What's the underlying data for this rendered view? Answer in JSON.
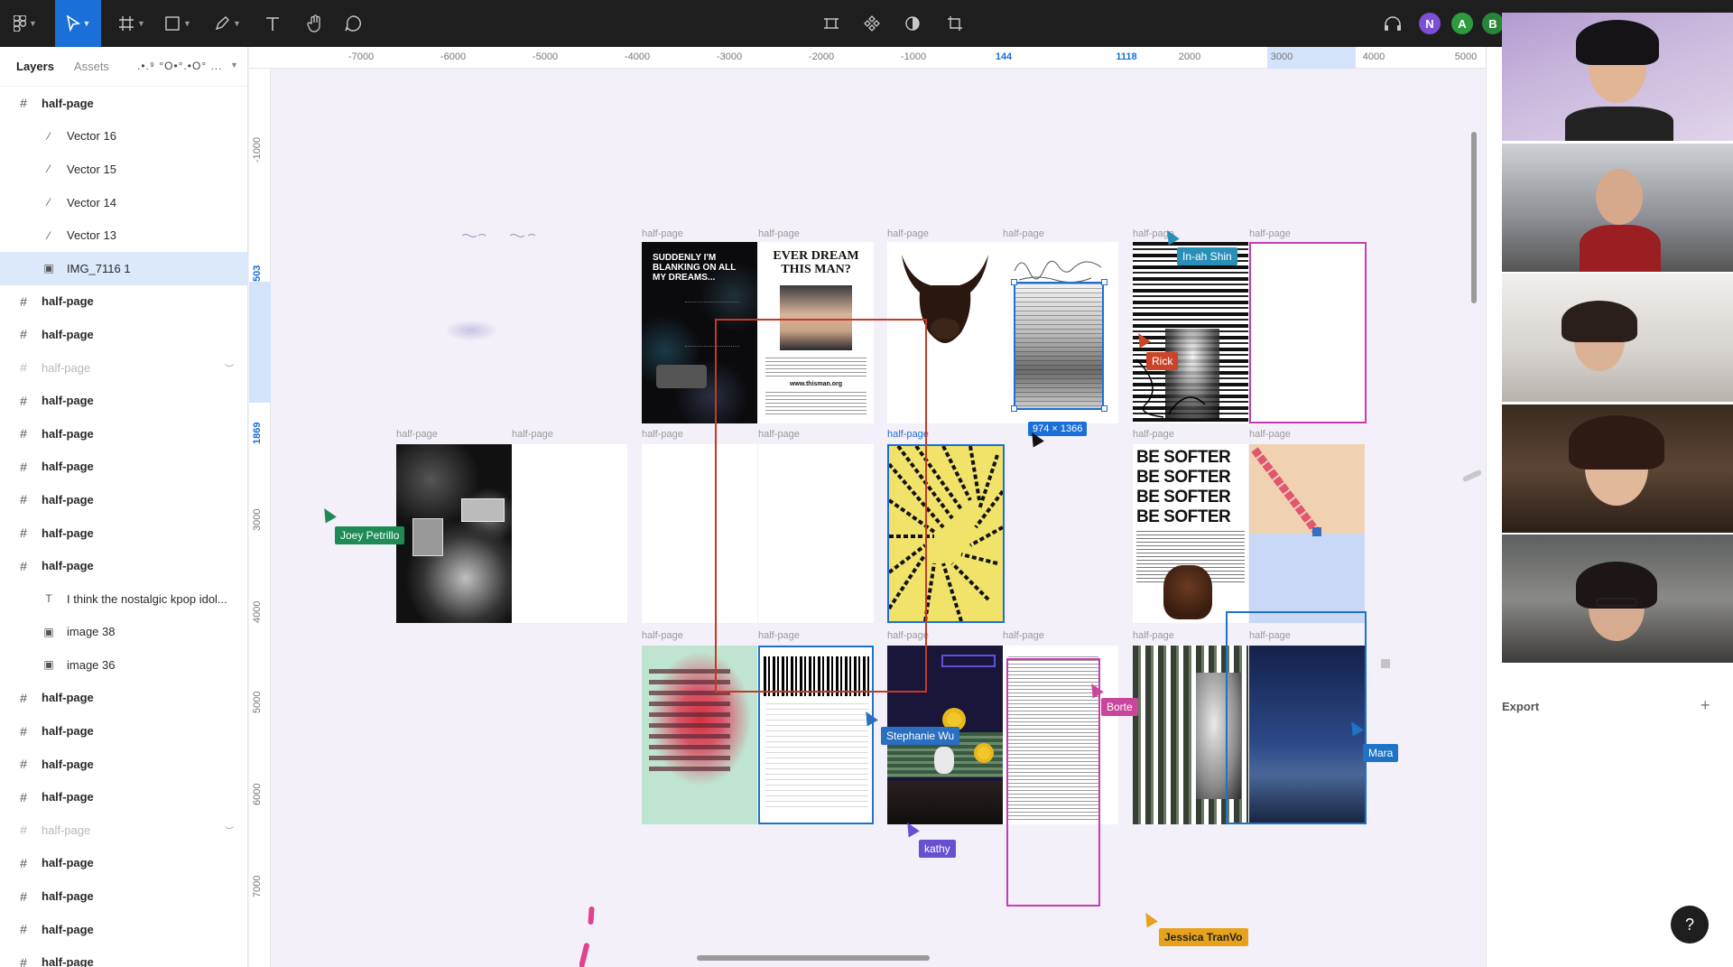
{
  "toolbar": {
    "tools": [
      "figma-menu-icon",
      "move-tool-icon",
      "frame-tool-icon",
      "shape-tool-icon",
      "pen-tool-icon",
      "text-tool-icon",
      "hand-tool-icon",
      "comment-tool-icon"
    ],
    "center_tools": [
      "component-icon",
      "components-icon",
      "mask-icon",
      "crop-icon"
    ],
    "users": [
      {
        "initial": "N",
        "color": "#7b4fd6"
      },
      {
        "initial": "A",
        "color": "#2e9a3e"
      },
      {
        "initial": "B",
        "color": "#27853a"
      }
    ]
  },
  "layers_panel": {
    "tabs": {
      "layers": "Layers",
      "assets": "Assets"
    },
    "page_name": ".•.⁹ °O•°.•O° ...",
    "items": [
      {
        "name": "half-page",
        "kind": "frame",
        "level": "top"
      },
      {
        "name": "Vector 16",
        "kind": "vector",
        "level": "child"
      },
      {
        "name": "Vector 15",
        "kind": "vector",
        "level": "child"
      },
      {
        "name": "Vector 14",
        "kind": "vector",
        "level": "child"
      },
      {
        "name": "Vector 13",
        "kind": "vector",
        "level": "child"
      },
      {
        "name": "IMG_7116 1",
        "kind": "image",
        "level": "child",
        "selected": true
      },
      {
        "name": "half-page",
        "kind": "frame",
        "level": "top"
      },
      {
        "name": "half-page",
        "kind": "frame",
        "level": "top"
      },
      {
        "name": "half-page",
        "kind": "frame",
        "level": "top",
        "hidden": true
      },
      {
        "name": "half-page",
        "kind": "frame",
        "level": "top"
      },
      {
        "name": "half-page",
        "kind": "frame",
        "level": "top"
      },
      {
        "name": "half-page",
        "kind": "frame",
        "level": "top"
      },
      {
        "name": "half-page",
        "kind": "frame",
        "level": "top"
      },
      {
        "name": "half-page",
        "kind": "frame",
        "level": "top"
      },
      {
        "name": "half-page",
        "kind": "frame",
        "level": "top"
      },
      {
        "name": "I think the nostalgic kpop idol...",
        "kind": "text",
        "level": "child"
      },
      {
        "name": "image 38",
        "kind": "image",
        "level": "child"
      },
      {
        "name": "image 36",
        "kind": "image",
        "level": "child"
      },
      {
        "name": "half-page",
        "kind": "frame",
        "level": "top"
      },
      {
        "name": "half-page",
        "kind": "frame",
        "level": "top"
      },
      {
        "name": "half-page",
        "kind": "frame",
        "level": "top"
      },
      {
        "name": "half-page",
        "kind": "frame",
        "level": "top"
      },
      {
        "name": "half-page",
        "kind": "frame",
        "level": "top",
        "hidden": true
      },
      {
        "name": "half-page",
        "kind": "frame",
        "level": "top"
      },
      {
        "name": "half-page",
        "kind": "frame",
        "level": "top"
      },
      {
        "name": "half-page",
        "kind": "frame",
        "level": "top"
      },
      {
        "name": "half-page",
        "kind": "frame",
        "level": "top"
      }
    ]
  },
  "ruler_top": [
    "-7000",
    "-6000",
    "-5000",
    "-4000",
    "-3000",
    "-2000",
    "-1000",
    "144",
    "1118",
    "2000",
    "3000",
    "4000",
    "5000"
  ],
  "ruler_top_selected": [
    "144",
    "1118"
  ],
  "ruler_left": [
    "-1000",
    "503",
    "1869",
    "3000",
    "4000",
    "5000",
    "6000",
    "7000"
  ],
  "ruler_left_selected": [
    "503",
    "1869"
  ],
  "canvas": {
    "frame_label": "half-page",
    "selection_size": "974 × 1366",
    "frames": [
      {
        "art": "poster-suddenly",
        "text": "SUDDENLY I'M BLANKING ON ALL MY DREAMS..."
      },
      {
        "art": "poster-dream-man",
        "text": "EVER DREAM THIS MAN?",
        "footer": "www.thisman.org"
      },
      {
        "art": "bull",
        "text": ""
      },
      {
        "art": "scribble-doc",
        "text": ""
      },
      {
        "art": "glitch-bw",
        "text": ""
      },
      {
        "art": "blank-pink",
        "text": ""
      },
      {
        "art": "night-collage",
        "text": ""
      },
      {
        "art": "blank",
        "text": ""
      },
      {
        "art": "blank",
        "text": ""
      },
      {
        "art": "blank",
        "text": ""
      },
      {
        "art": "yellow-zebra",
        "text": ""
      },
      {
        "art": "be-softer",
        "text": "BE SOFTER BE SOFTER BE SOFTER BE SOFTER"
      },
      {
        "art": "pixel-diagonal",
        "text": ""
      },
      {
        "art": "red-blur",
        "text": ""
      },
      {
        "art": "glitch-text",
        "text": ""
      },
      {
        "art": "sunflower-night",
        "text": ""
      },
      {
        "art": "text-doc",
        "text": ""
      },
      {
        "art": "ivy-face",
        "text": ""
      },
      {
        "art": "night-sea",
        "text": ""
      }
    ],
    "cursors": [
      {
        "name": "In-ah Shin",
        "color": "#2a8fb8"
      },
      {
        "name": "Rick",
        "color": "#c9452a"
      },
      {
        "name": "Joey Petrillo",
        "color": "#1e8a55"
      },
      {
        "name": "Stephanie Wu",
        "color": "#2a6fc0"
      },
      {
        "name": "kathy",
        "color": "#6a4fd0"
      },
      {
        "name": "Borte",
        "color": "#c8479c"
      },
      {
        "name": "Mara",
        "color": "#1f73c6"
      },
      {
        "name": "Jessica TranVo",
        "color": "#e6a21a"
      }
    ]
  },
  "right_panel": {
    "export_label": "Export",
    "add_icon": "plus-icon"
  },
  "help": "?"
}
